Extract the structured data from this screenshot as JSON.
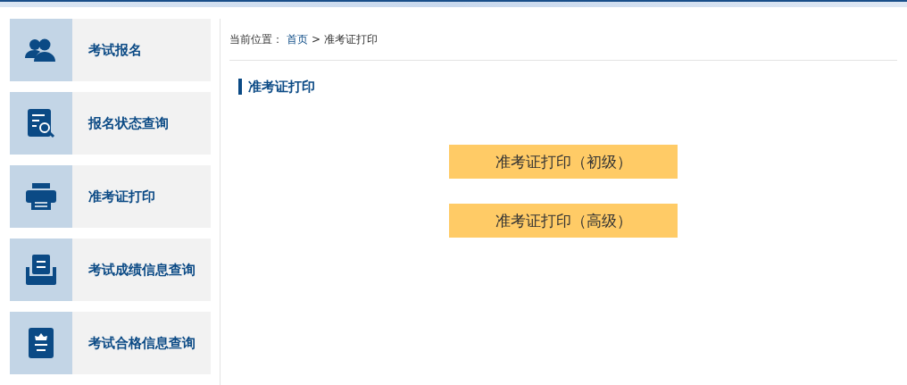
{
  "sidebar": {
    "items": [
      {
        "kind": "people",
        "label": "考试报名"
      },
      {
        "kind": "document-search",
        "label": "报名状态查询"
      },
      {
        "kind": "printer",
        "label": "准考证打印"
      },
      {
        "kind": "tray",
        "label": "考试成绩信息查询"
      },
      {
        "kind": "certificate",
        "label": "考试合格信息查询"
      }
    ]
  },
  "breadcrumb": {
    "prefix": "当前位置：",
    "home": "首页",
    "separator": ">",
    "current": "准考证打印"
  },
  "section_title": "准考证打印",
  "buttons": [
    "准考证打印（初级）",
    "准考证打印（高级）"
  ]
}
